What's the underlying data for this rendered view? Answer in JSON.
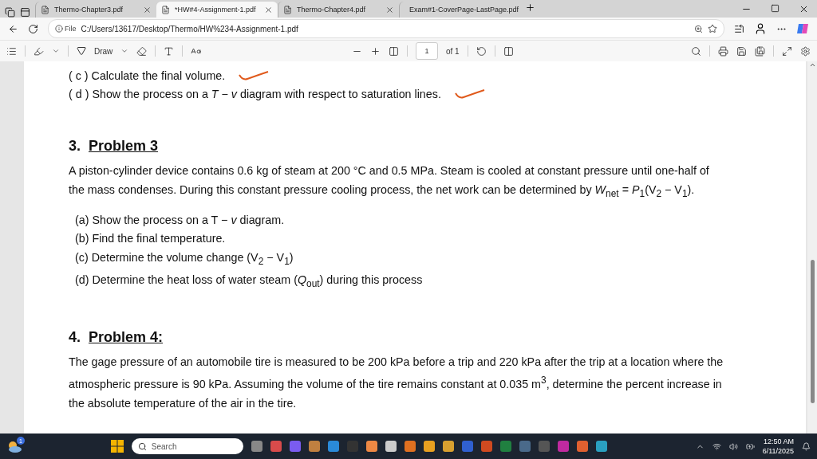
{
  "tabs": [
    {
      "label": "Thermo-Chapter3.pdf",
      "selected": false
    },
    {
      "label": "*HW#4-Assignment-1.pdf",
      "selected": true
    },
    {
      "label": "Thermo-Chapter4.pdf",
      "selected": false
    },
    {
      "label": "Exam#1-CoverPage-LastPage.pdf",
      "selected": false
    }
  ],
  "address": {
    "badge": "File",
    "url": "C:/Users/13617/Desktop/Thermo/HW%234-Assignment-1.pdf"
  },
  "toolbar": {
    "draw_label": "Draw",
    "page_value": "1",
    "page_total": "of 1"
  },
  "document": [
    {
      "kind": "item",
      "text": "( c ) Calculate the final volume.",
      "marked": true
    },
    {
      "kind": "item",
      "text": "( d ) Show the process on a *T* − *v* diagram with respect to saturation lines.",
      "marked": true
    },
    {
      "kind": "heading",
      "number": "3.",
      "text": "Problem 3"
    },
    {
      "kind": "paragraph",
      "text": "A piston-cylinder device contains 0.6 kg of steam at 200 °C and 0.5 MPa. Steam is cooled at constant pressure until one-half of the mass condenses. During this constant pressure cooling process, the net work can be determined by *W*$_{net}$ = *P*$_{1}$(V$_{2}$ − V$_{1}$)."
    },
    {
      "kind": "subitem",
      "text": "(a) Show the process on a T − *v* diagram.",
      "marked": false
    },
    {
      "kind": "subitem",
      "text": "(b) Find the final temperature.",
      "marked": false
    },
    {
      "kind": "subitem",
      "text": "(c) Determine the volume change (V$_{2}$ − V$_{1}$)",
      "marked": false
    },
    {
      "kind": "subitem",
      "text": "(d) Determine the heat loss of water steam (*Q*$_{out}$) during this process",
      "marked": false
    },
    {
      "kind": "heading",
      "number": "4.",
      "text": "Problem 4:"
    },
    {
      "kind": "paragraph",
      "text": "The gage pressure of an automobile tire is measured to be 200 kPa before a trip and 220 kPa after the trip at a location where the atmospheric pressure is 90 kPa. Assuming the volume of the tire remains constant at 0.035 m$^{3}$, determine the percent increase in the absolute temperature of the air in the tire."
    }
  ],
  "taskbar": {
    "weather_badge": "1",
    "search_placeholder": "Search",
    "time": "12:50 AM",
    "date": "6/11/2025"
  }
}
